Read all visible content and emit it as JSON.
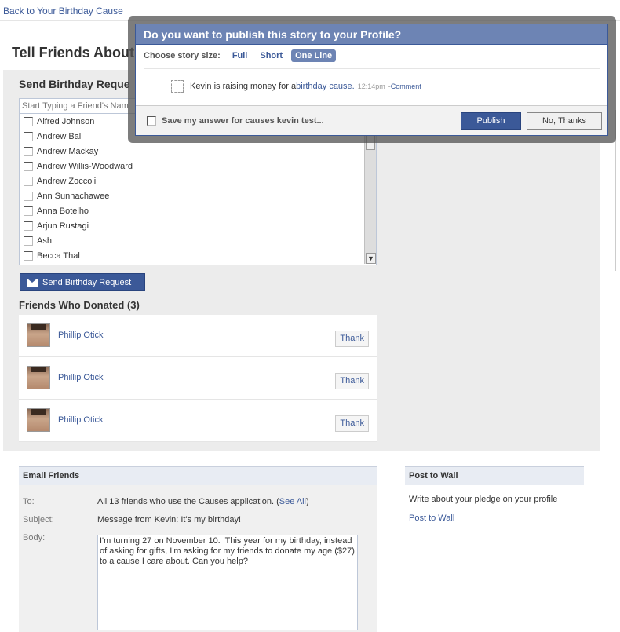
{
  "back_link": "Back to Your Birthday Cause",
  "page_title": "Tell Friends About",
  "send_section": {
    "title": "Send Birthday Reque",
    "search_placeholder": "Start Typing a Friend's Nam",
    "friends": [
      "Alfred Johnson",
      "Andrew Ball",
      "Andrew Mackay",
      "Andrew Willis-Woodward",
      "Andrew Zoccoli",
      "Ann Sunhachawee",
      "Anna Botelho",
      "Arjun Rustagi",
      "Ash",
      "Becca Thal"
    ],
    "send_button": "Send Birthday Request"
  },
  "donated": {
    "title": "Friends Who Donated (3)",
    "donors": [
      {
        "name": "Phillip Otick",
        "action": "Thank"
      },
      {
        "name": "Phillip Otick",
        "action": "Thank"
      },
      {
        "name": "Phillip Otick",
        "action": "Thank"
      }
    ]
  },
  "email": {
    "header": "Email Friends",
    "to_label": "To:",
    "to_text": "All 13 friends who use the Causes application. (",
    "see_all": "See All",
    "to_close": ")",
    "subject_label": "Subject:",
    "subject_value": "Message from Kevin: It's my birthday!",
    "body_label": "Body:",
    "body_value": "I'm turning 27 on November 10.  This year for my birthday, instead of asking for gifts, I'm asking for my friends to donate my age ($27) to a cause I care about. Can you help?"
  },
  "wall": {
    "header": "Post to Wall",
    "text": "Write about your pledge on your profile",
    "link": "Post to Wall"
  },
  "modal": {
    "title": "Do you want to publish this story to your Profile?",
    "size_label": "Choose story size:",
    "sizes": [
      "Full",
      "Short",
      "One Line"
    ],
    "selected_size": "One Line",
    "story_text": "Kevin is raising money for a ",
    "story_link": "birthday cause.",
    "story_time": "12:14pm",
    "story_sep": " - ",
    "story_comment": "Comment",
    "save_answer": "Save my answer for causes kevin test...",
    "publish": "Publish",
    "no_thanks": "No, Thanks"
  },
  "colors": {
    "brand": "#3b5998",
    "modal_header": "#6d84b4",
    "panel_gray": "#ececec"
  }
}
